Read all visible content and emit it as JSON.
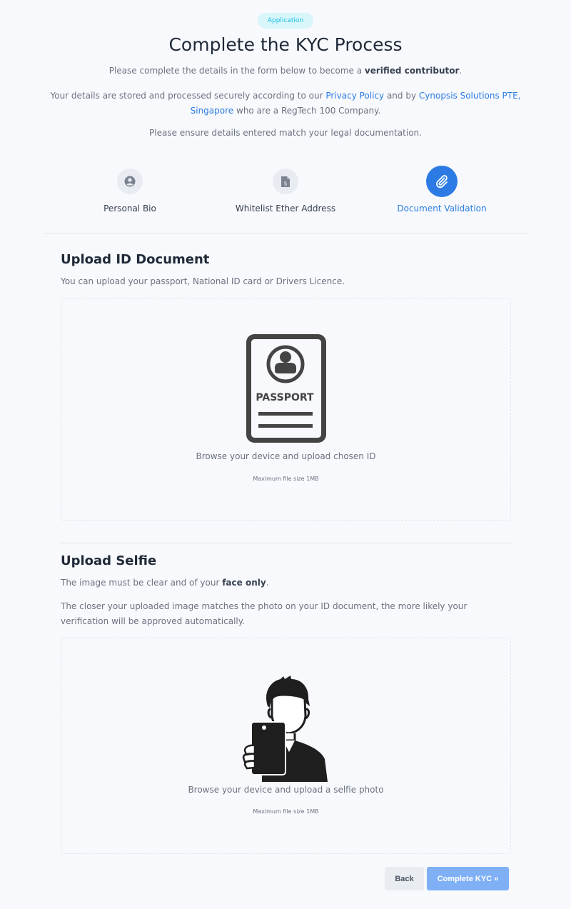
{
  "badge": "Application",
  "title": "Complete the KYC Process",
  "intro": {
    "line1_prefix": "Please complete the details in the form below to become a",
    "line1_bold": "verified contributor",
    "line1_suffix": ".",
    "line2_a": "Your details are stored and processed securely according to our",
    "privacy_link": "Privacy Policy",
    "line2_b": "and by",
    "cynopsis_link": "Cynopsis Solutions PTE, Singapore",
    "line2_c": "who are a RegTech 100 Company.",
    "line3": "Please ensure details entered match your legal documentation."
  },
  "steps": [
    {
      "label": "Personal Bio",
      "icon": "user-circle-icon",
      "active": false
    },
    {
      "label": "Whitelist Ether Address",
      "icon": "dollar-document-icon",
      "active": false
    },
    {
      "label": "Document Validation",
      "icon": "paperclip-icon",
      "active": true
    }
  ],
  "id_section": {
    "title": "Upload ID Document",
    "description": "You can upload your passport, National ID card or Drivers Licence.",
    "passport_text": "PASSPORT",
    "browse_text": "Browse your device and upload chosen ID",
    "max_size": "Maximum file size 1MB"
  },
  "selfie_section": {
    "title": "Upload Selfie",
    "desc1_prefix": "The image must be clear and of your",
    "desc1_bold": "face only",
    "desc1_suffix": ".",
    "desc2": "The closer your uploaded image matches the photo on your ID document, the more likely your verification will be approved automatically.",
    "browse_text": "Browse your device and upload a selfie photo",
    "max_size": "Maximum file size 1MB"
  },
  "buttons": {
    "back": "Back",
    "complete": "Complete KYC »"
  },
  "colors": {
    "accent": "#2c7be5",
    "badge_bg": "#d9f6fb",
    "badge_text": "#17c1e8",
    "complete_button": "#7fb0f6"
  }
}
